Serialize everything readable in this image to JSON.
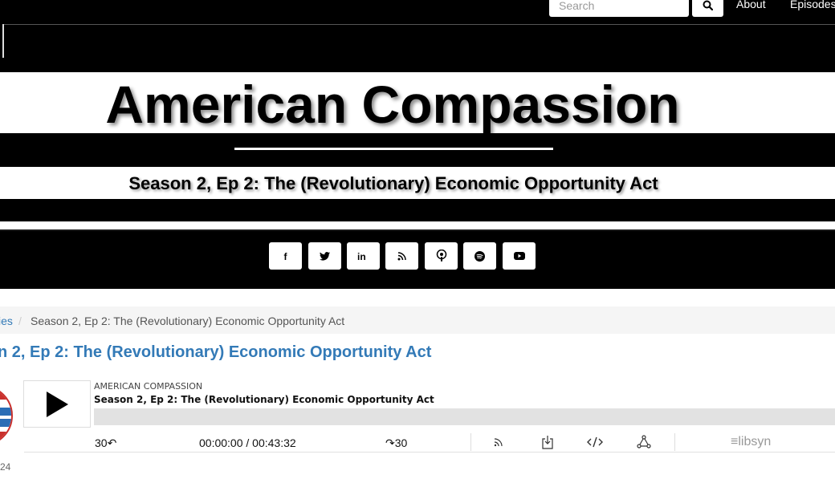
{
  "nav": {
    "search_placeholder": "Search",
    "links": [
      "About",
      "Episodes"
    ]
  },
  "header": {
    "site_title": "American Compassion",
    "episode_heading": "Season 2, Ep 2: The (Revolutionary) Economic Opportunity Act"
  },
  "social": {
    "icons": [
      "facebook-icon",
      "twitter-icon",
      "linkedin-icon",
      "rss-icon",
      "podcast-icon",
      "spotify-icon",
      "youtube-icon"
    ]
  },
  "breadcrumb": {
    "parent": "ies",
    "separator": "/",
    "current": "Season 2, Ep 2: The (Revolutionary) Economic Opportunity Act"
  },
  "post": {
    "title": "n 2, Ep 2: The (Revolutionary) Economic Opportunity Act",
    "date_fragment": "24"
  },
  "player": {
    "show_name": "AMERICAN COMPASSION",
    "episode_title": "Season 2, Ep 2: The (Revolutionary) Economic Opportunity Act",
    "rewind_label": "30↶",
    "time": "00:00:00 / 00:43:32",
    "forward_label": "↷30",
    "brand": "≡libsyn",
    "progress": 0
  },
  "colors": {
    "link": "#337ab7",
    "background_dark": "#000000"
  }
}
